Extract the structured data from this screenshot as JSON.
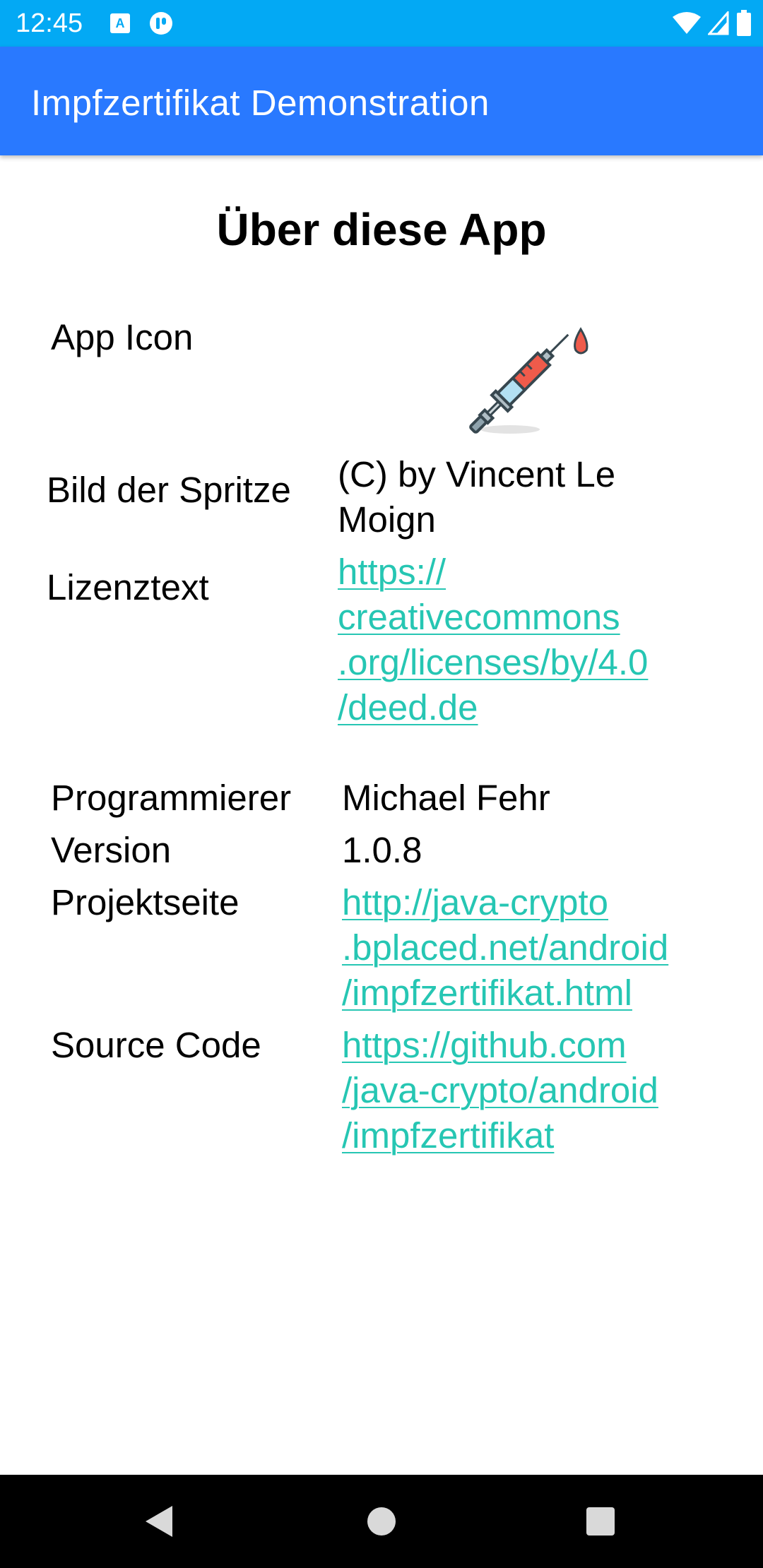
{
  "status_bar": {
    "time": "12:45",
    "notification_icons": [
      "keyboard-a-icon",
      "notification-app-icon"
    ],
    "right_icons": [
      "wifi-icon",
      "cell-signal-icon",
      "battery-icon"
    ],
    "background_color": "#03a9f4"
  },
  "app_bar": {
    "title": "Impfzertifikat Demonstration",
    "background_color": "#2979ff"
  },
  "page": {
    "title": "Über diese App"
  },
  "info": {
    "app_icon_label": "App Icon",
    "app_icon": "syringe-icon",
    "image_label": "Bild der Spritze",
    "image_credit_lines": [
      "(C) by Vincent Le",
      "Moign"
    ],
    "license_label": "Lizenztext",
    "license_link_lines": [
      "https://",
      "creativecommons",
      ".org/licenses/by/4.0",
      "/deed.de"
    ],
    "programmer_label": "Programmierer",
    "programmer_value": "Michael Fehr",
    "version_label": "Version",
    "version_value": "1.0.8",
    "project_label": "Projektseite",
    "project_link_lines": [
      "http://java-crypto",
      ".bplaced.net/android",
      "/impfzertifikat.html"
    ],
    "source_label": "Source Code",
    "source_link_lines": [
      "https://github.com",
      "/java-crypto/android",
      "/impfzertifikat"
    ],
    "link_color": "#26c6b3"
  },
  "nav_bar": {
    "buttons": [
      "back-icon",
      "home-icon",
      "recents-icon"
    ]
  }
}
